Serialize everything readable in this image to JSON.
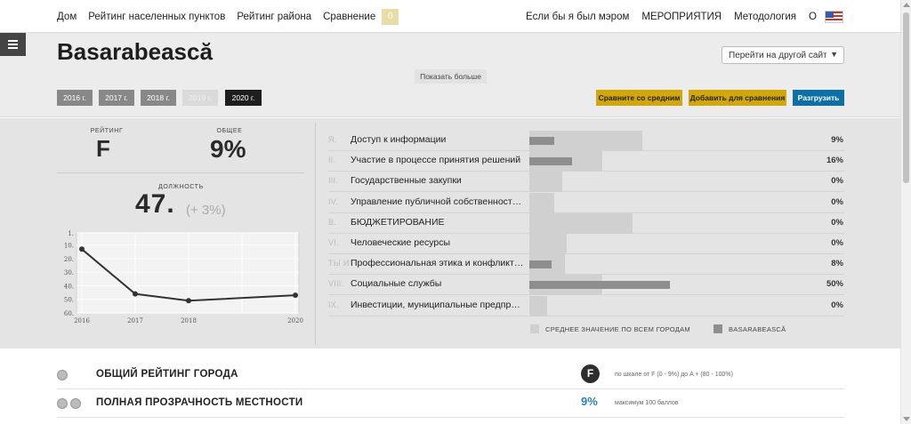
{
  "nav": {
    "left": [
      "Дом",
      "Рейтинг населенных пунктов",
      "Рейтинг района",
      "Сравнение"
    ],
    "compare_count": "0",
    "right": [
      "Если бы я был мэром",
      "МЕРОПРИЯТИЯ",
      "Методология",
      "О"
    ]
  },
  "header": {
    "city": "Basarabească",
    "site_select": "Перейти на другой сайт",
    "show_more": "Показать больше",
    "years": [
      "2016 г.",
      "2017 г.",
      "2018 г.",
      "2019 г.",
      "2020 г."
    ],
    "active_year": "2020 г.",
    "actions": {
      "compare_avg": "Сравните со средним",
      "add_compare": "Добавить для сравнения",
      "download": "Разгрузить"
    }
  },
  "summary": {
    "rating_label": "РЕЙТИНГ",
    "rating_value": "F",
    "total_label": "ОБЩЕЕ",
    "total_value": "9%",
    "position_label": "ДОЛЖНОСТЬ",
    "position_value": "47.",
    "position_change": "(+ 3%)"
  },
  "chart_data": {
    "type": "line",
    "x": [
      "2016",
      "2017",
      "2018",
      "2020"
    ],
    "y": [
      13,
      46,
      51,
      47
    ],
    "yticks": [
      "1.",
      "10.",
      "20.",
      "30.",
      "40.",
      "50.",
      "60."
    ],
    "ylim": [
      1,
      60
    ],
    "y_inverted": true,
    "grid": true,
    "line_color": "#333333"
  },
  "indicators": [
    {
      "num": "Я.",
      "name": "Доступ к информации",
      "avg": 45,
      "city": 10,
      "value": "9%"
    },
    {
      "num": "II.",
      "name": "Участие в процессе принятия решений",
      "avg": 29,
      "city": 17,
      "value": "16%"
    },
    {
      "num": "III.",
      "name": "Государственные закупки",
      "avg": 13,
      "city": 0,
      "value": "0%"
    },
    {
      "num": "IV.",
      "name": "Управление публичной собственностью",
      "avg": 10,
      "city": 0,
      "value": "0%"
    },
    {
      "num": "В.",
      "name": "БЮДЖЕТИРОВАНИЕ",
      "avg": 41,
      "city": 0,
      "value": "0%"
    },
    {
      "num": "VI.",
      "name": "Человеческие ресурсы",
      "avg": 15,
      "city": 0,
      "value": "0%"
    },
    {
      "num": "ТЫ И",
      "name": "Профессиональная этика и конфликт интересов",
      "avg": 14,
      "city": 9,
      "value": "8%"
    },
    {
      "num": "VIII.",
      "name": "Социальные службы",
      "avg": 29,
      "city": 56,
      "value": "50%"
    },
    {
      "num": "IX.",
      "name": "Инвестиции, муниципальные предприятия",
      "avg": 7,
      "city": 0,
      "value": "0%"
    }
  ],
  "legend": {
    "avg": "СРЕДНЕЕ ЗНАЧЕНИЕ ПО ВСЕМ ГОРОДАМ",
    "city": "BASARABEASCĂ"
  },
  "rows": [
    {
      "title": "ОБЩИЙ РЕЙТИНГ ГОРОДА",
      "grade": "F",
      "note": "по шкале от F (0 - 9%) до A + (80 - 100%)"
    },
    {
      "title": "ПОЛНАЯ ПРОЗРАЧНОСТЬ МЕСТНОСТИ",
      "value": "9%",
      "note": "максимум 100 баллов"
    }
  ],
  "colors": {
    "accent_yellow": "#d1a70a",
    "accent_blue": "#0d6fa8",
    "percent_blue": "#2b7fb8",
    "bar_avg": "#d0d0d0",
    "bar_city": "#8e8e8e"
  }
}
